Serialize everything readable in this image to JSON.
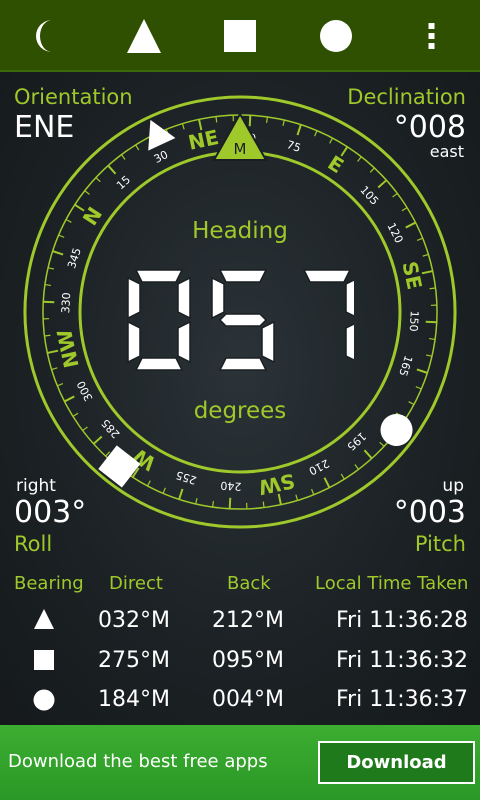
{
  "colors": {
    "accent": "#9fc92b",
    "toolbar_bg": "#2e5000",
    "ad_bg": "#33a52c"
  },
  "toolbar": {
    "buttons": [
      {
        "name": "night-mode",
        "icon": "crescent-moon-icon"
      },
      {
        "name": "triangle-marker",
        "icon": "triangle-icon"
      },
      {
        "name": "square-marker",
        "icon": "square-icon"
      },
      {
        "name": "circle-marker",
        "icon": "circle-icon"
      },
      {
        "name": "overflow-menu",
        "icon": "more-vert-icon"
      }
    ]
  },
  "orientation": {
    "label": "Orientation",
    "value": "ENE"
  },
  "declination": {
    "label": "Declination",
    "value": "°008",
    "direction": "east"
  },
  "roll": {
    "direction": "right",
    "value": "003°",
    "label": "Roll"
  },
  "pitch": {
    "direction": "up",
    "value": "°003",
    "label": "Pitch"
  },
  "heading": {
    "label": "Heading",
    "value": "057",
    "unit": "degrees",
    "heading_deg": 57
  },
  "compass": {
    "cardinals": [
      {
        "text": "N",
        "deg": 0
      },
      {
        "text": "NE",
        "deg": 45
      },
      {
        "text": "E",
        "deg": 90
      },
      {
        "text": "SE",
        "deg": 135
      },
      {
        "text": "SW",
        "deg": 225
      },
      {
        "text": "W",
        "deg": 270
      },
      {
        "text": "NW",
        "deg": 315
      }
    ],
    "numbers": [
      {
        "text": "15",
        "deg": 15
      },
      {
        "text": "30",
        "deg": 30
      },
      {
        "text": "60",
        "deg": 60
      },
      {
        "text": "75",
        "deg": 75
      },
      {
        "text": "105",
        "deg": 105
      },
      {
        "text": "120",
        "deg": 120
      },
      {
        "text": "150",
        "deg": 150
      },
      {
        "text": "165",
        "deg": 165
      },
      {
        "text": "195",
        "deg": 195
      },
      {
        "text": "210",
        "deg": 210
      },
      {
        "text": "240",
        "deg": 240
      },
      {
        "text": "255",
        "deg": 255
      },
      {
        "text": "285",
        "deg": 285
      },
      {
        "text": "300",
        "deg": 300
      },
      {
        "text": "330",
        "deg": 330
      },
      {
        "text": "345",
        "deg": 345
      }
    ],
    "lubber_label": "M",
    "markers": [
      {
        "shape": "triangle",
        "deg": 32
      },
      {
        "shape": "square",
        "deg": 275
      },
      {
        "shape": "circle",
        "deg": 184
      }
    ]
  },
  "table": {
    "headers": {
      "bearing": "Bearing",
      "direct": "Direct",
      "back": "Back",
      "time": "Local Time Taken"
    },
    "rows": [
      {
        "icon": "triangle-icon",
        "direct": "032°M",
        "back": "212°M",
        "time": "Fri 11:36:28"
      },
      {
        "icon": "square-icon",
        "direct": "275°M",
        "back": "095°M",
        "time": "Fri 11:36:32"
      },
      {
        "icon": "circle-icon",
        "direct": "184°M",
        "back": "004°M",
        "time": "Fri 11:36:37"
      }
    ]
  },
  "ad": {
    "text": "Download the best free apps",
    "button": "Download"
  }
}
